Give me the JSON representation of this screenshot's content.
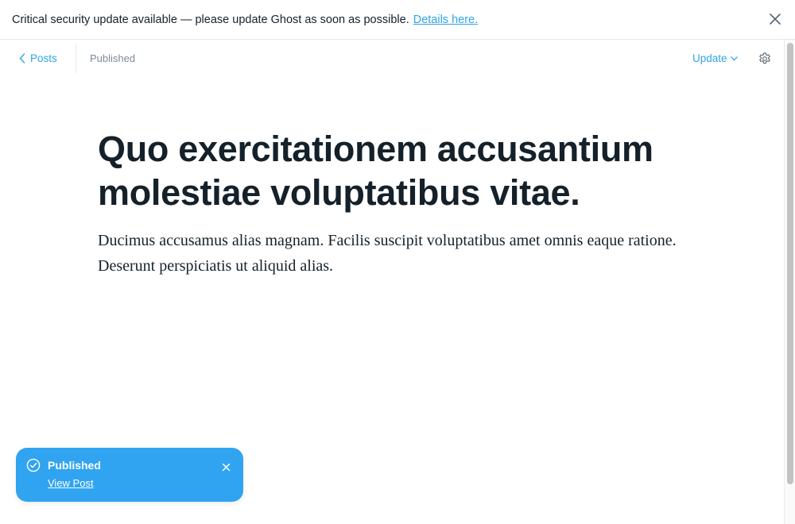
{
  "alert": {
    "message": "Critical security update available — please update Ghost as soon as possible.",
    "link_text": "Details here.",
    "close_icon": "close-icon"
  },
  "header": {
    "back_label": "Posts",
    "back_icon": "chevron-left-icon",
    "status": "Published",
    "update_label": "Update",
    "update_icon": "chevron-down-icon",
    "settings_icon": "gear-icon"
  },
  "post": {
    "title": "Quo exercitationem accusantium molestiae voluptatibus vitae.",
    "excerpt": "Ducimus accusamus alias magnam. Facilis suscipit voluptatibus amet omnis eaque ratione. Deserunt perspiciatis ut aliquid alias."
  },
  "toast": {
    "title": "Published",
    "link_text": "View Post",
    "icon": "check-circle-icon",
    "close_icon": "close-icon"
  },
  "colors": {
    "accent": "#30a4e8",
    "toast_bg": "#30a4f0",
    "text": "#15212a",
    "muted": "#7c8b9a"
  }
}
